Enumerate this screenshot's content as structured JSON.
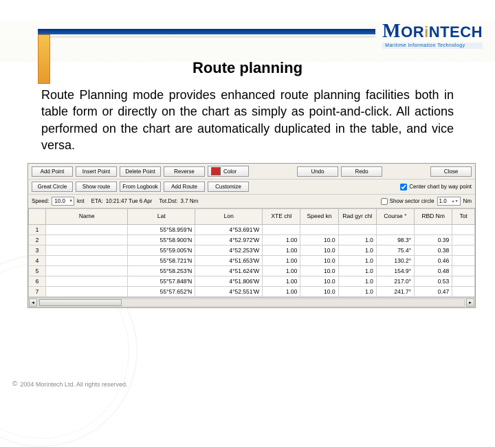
{
  "logo": {
    "m": "M",
    "rest1": "OR",
    "accent": "i",
    "rest2": "NTECH",
    "tagline": "Maritime Information Technology"
  },
  "title": "Route planning",
  "intro": "Route Planning mode provides enhanced route planning facilities both in table form or directly on the chart as simply as point-and-click. All actions performed on the chart are automatically duplicated in the table, and vice versa.",
  "toolbar": {
    "row1": {
      "add": "Add Point",
      "insert": "Insert Point",
      "delete": "Delete Point",
      "reverse": "Reverse",
      "color": "Color",
      "undo": "Undo",
      "redo": "Redo",
      "close": "Close"
    },
    "row2": {
      "gc": "Great Circle",
      "show": "Show route",
      "fromlog": "From Logbook",
      "addroute": "Add Route",
      "customize": "Customize",
      "center": "Center chart by way point"
    },
    "row3": {
      "speed_lbl": "Speed:",
      "speed_val": "10.0",
      "unit": "knt",
      "eta_lbl": "ETA:",
      "eta_val": "10:21:47 Tue 6 Apr",
      "dist_lbl": "Tot.Dst:",
      "dist_val": "3.7 Nm",
      "sector_chk": "Show sector circle",
      "sector_val": "1.0",
      "nm": "Nm"
    }
  },
  "columns": {
    "num": "",
    "name": "Name",
    "lat": "Lat",
    "lon": "Lon",
    "xte": "XTE\nchl",
    "speed": "Speed\nkn",
    "rad": "Rad gyr\nchl",
    "course": "Course\n°",
    "rbd": "RBD\nNm",
    "tot": "Tot"
  },
  "rows": [
    {
      "n": "1",
      "name": "",
      "lat": "55°58.959'N",
      "lon": "4°53.691'W",
      "xte": "",
      "spd": "",
      "rad": "",
      "crs": "",
      "rbd": ""
    },
    {
      "n": "2",
      "name": "",
      "lat": "55°58.900'N",
      "lon": "4°52.972'W",
      "xte": "1.00",
      "spd": "10.0",
      "rad": "1.0",
      "crs": "98.3°",
      "rbd": "0.39"
    },
    {
      "n": "3",
      "name": "",
      "lat": "55°59.005'N",
      "lon": "4°52.253'W",
      "xte": "1.00",
      "spd": "10.0",
      "rad": "1.0",
      "crs": "75.4°",
      "rbd": "0.38"
    },
    {
      "n": "4",
      "name": "",
      "lat": "55°58.721'N",
      "lon": "4°51.653'W",
      "xte": "1.00",
      "spd": "10.0",
      "rad": "1.0",
      "crs": "130.2°",
      "rbd": "0.46"
    },
    {
      "n": "5",
      "name": "",
      "lat": "55°58.253'N",
      "lon": "4°51.624'W",
      "xte": "1.00",
      "spd": "10.0",
      "rad": "1.0",
      "crs": "154.9°",
      "rbd": "0.48"
    },
    {
      "n": "6",
      "name": "",
      "lat": "55°57.848'N",
      "lon": "4°51.806'W",
      "xte": "1.00",
      "spd": "10.0",
      "rad": "1.0",
      "crs": "217.0°",
      "rbd": "0.53"
    },
    {
      "n": "7",
      "name": "",
      "lat": "55°57.652'N",
      "lon": "4°52.551'W",
      "xte": "1.00",
      "spd": "10.0",
      "rad": "1.0",
      "crs": "241.7°",
      "rbd": "0.47"
    }
  ],
  "footer": "2004 Morintech Ltd. All rights reserved."
}
